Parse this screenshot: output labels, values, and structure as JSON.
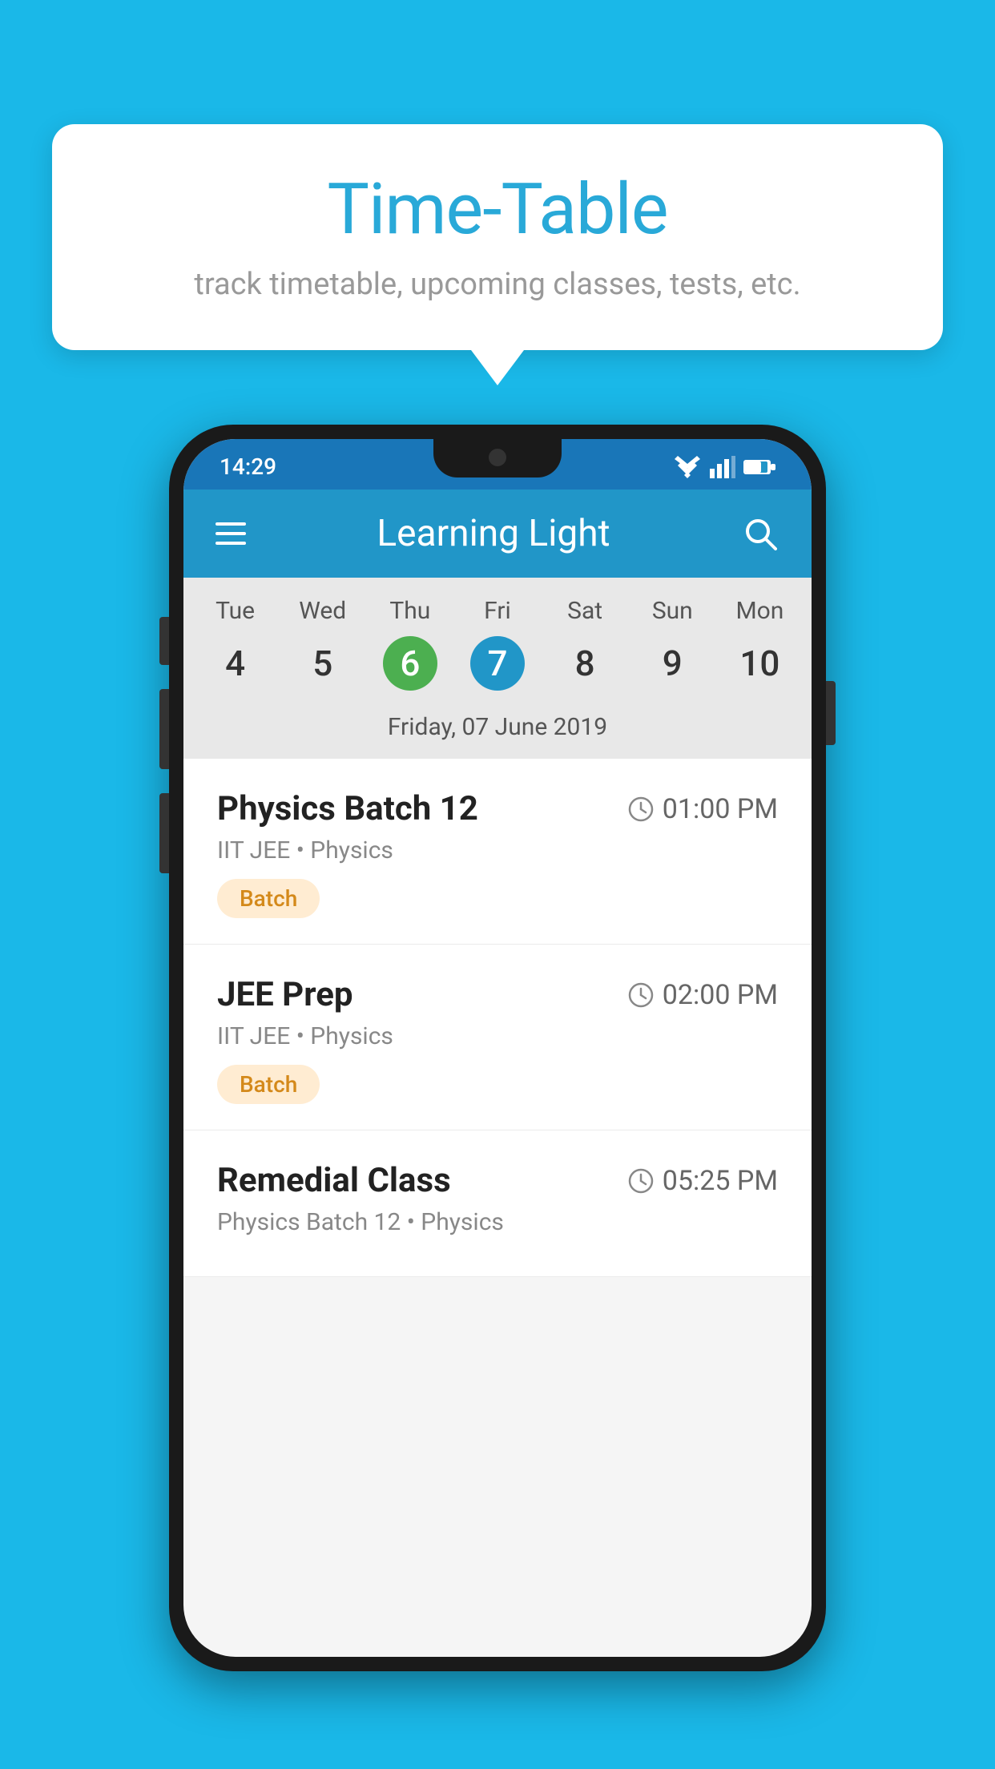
{
  "background_color": "#1ab8e8",
  "tooltip": {
    "title": "Time-Table",
    "subtitle": "track timetable, upcoming classes, tests, etc."
  },
  "app": {
    "status_bar": {
      "time": "14:29"
    },
    "app_bar": {
      "title": "Learning Light"
    },
    "calendar": {
      "days": [
        {
          "label": "Tue",
          "num": "4",
          "state": "normal"
        },
        {
          "label": "Wed",
          "num": "5",
          "state": "normal"
        },
        {
          "label": "Thu",
          "num": "6",
          "state": "today"
        },
        {
          "label": "Fri",
          "num": "7",
          "state": "selected"
        },
        {
          "label": "Sat",
          "num": "8",
          "state": "normal"
        },
        {
          "label": "Sun",
          "num": "9",
          "state": "normal"
        },
        {
          "label": "Mon",
          "num": "10",
          "state": "normal"
        }
      ],
      "selected_date_label": "Friday, 07 June 2019"
    },
    "schedule": {
      "items": [
        {
          "title": "Physics Batch 12",
          "time": "01:00 PM",
          "sub": "IIT JEE • Physics",
          "badge": "Batch"
        },
        {
          "title": "JEE Prep",
          "time": "02:00 PM",
          "sub": "IIT JEE • Physics",
          "badge": "Batch"
        },
        {
          "title": "Remedial Class",
          "time": "05:25 PM",
          "sub": "Physics Batch 12 • Physics",
          "badge": null
        }
      ]
    }
  }
}
